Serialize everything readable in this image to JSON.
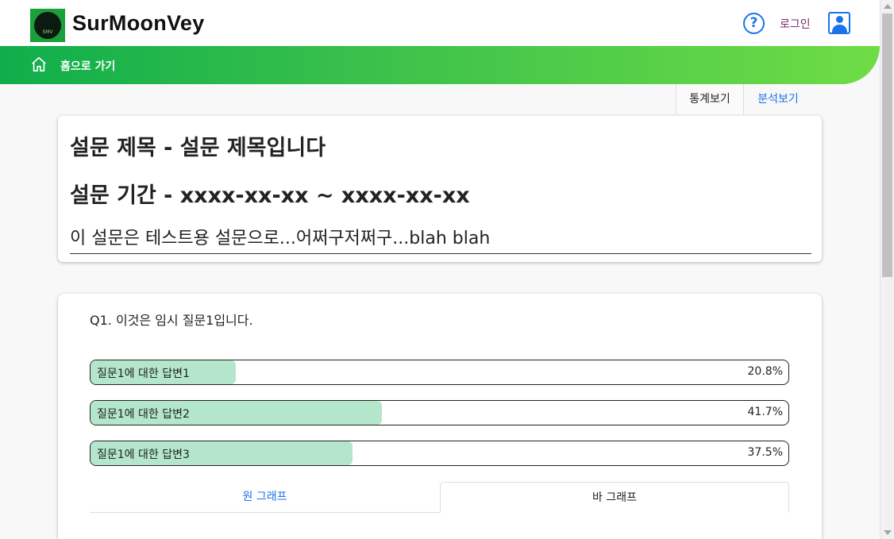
{
  "header": {
    "brand": "SurMoonVey",
    "logo_text": "SMV",
    "help_icon": "question-circle-icon",
    "login_label": "로그인",
    "user_icon": "user-profile-icon",
    "accent_color": "#1a73e8"
  },
  "nav": {
    "home_icon": "home-icon",
    "home_label": "홈으로 가기",
    "gradient_colors": [
      "#0fae4b",
      "#6fdc45"
    ]
  },
  "view_tabs": {
    "stats_label": "통계보기",
    "analysis_label": "분석보기",
    "active": "stats"
  },
  "survey": {
    "title": "설문 제목 - 설문 제목입니다",
    "period": "설문 기간 - xxxx-xx-xx ~ xxxx-xx-xx",
    "description": "이 설문은 테스트용 설문으로...어쩌구저쩌구...blah blah"
  },
  "question": {
    "title": "Q1. 이것은 임시 질문1입니다.",
    "answers": [
      {
        "label": "질문1에 대한 답변1",
        "percent_text": "20.8%",
        "percent": 20.8
      },
      {
        "label": "질문1에 대한 답변2",
        "percent_text": "41.7%",
        "percent": 41.7
      },
      {
        "label": "질문1에 대한 답변3",
        "percent_text": "37.5%",
        "percent": 37.5
      }
    ],
    "bar_fill_color": "#b3e6cb",
    "graph_tabs": {
      "pie_label": "원 그래프",
      "bar_label": "바 그래프",
      "active": "bar"
    }
  }
}
